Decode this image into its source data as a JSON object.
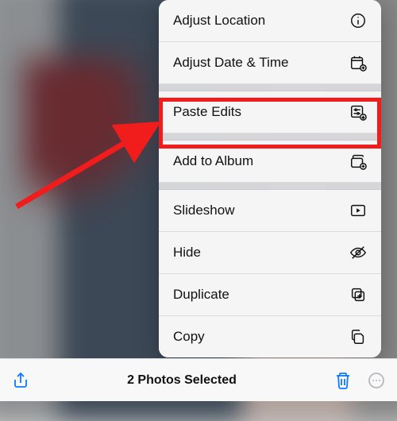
{
  "menu": {
    "adjust_location": "Adjust Location",
    "adjust_datetime": "Adjust Date & Time",
    "paste_edits": "Paste Edits",
    "add_to_album": "Add to Album",
    "slideshow": "Slideshow",
    "hide": "Hide",
    "duplicate": "Duplicate",
    "copy": "Copy"
  },
  "toolbar": {
    "status": "2 Photos Selected"
  },
  "annotation": {
    "highlighted_item": "Paste Edits"
  }
}
